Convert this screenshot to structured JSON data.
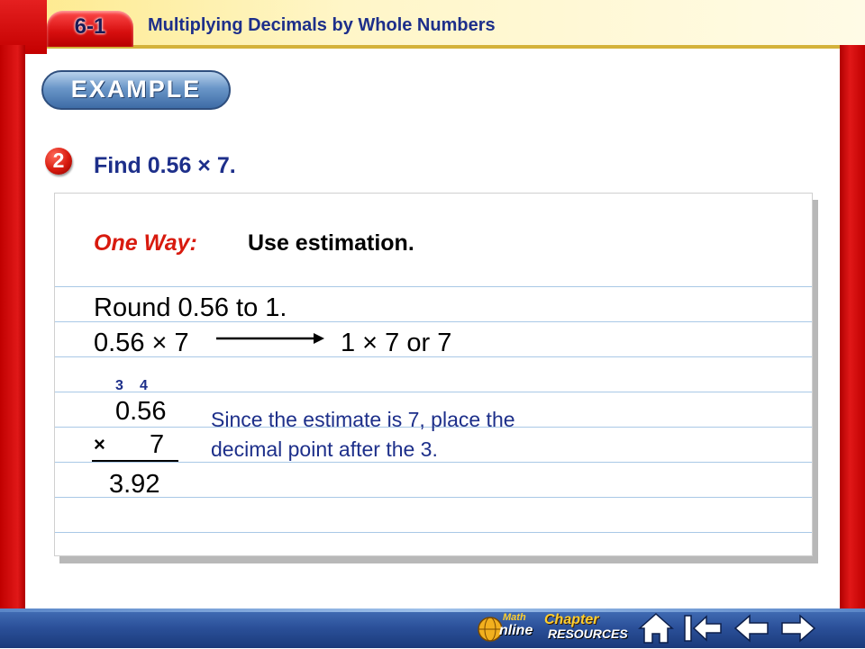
{
  "header": {
    "lesson_number": "6-1",
    "lesson_title": "Multiplying Decimals by Whole Numbers"
  },
  "example_badge": "EXAMPLE",
  "problem": {
    "number": "2",
    "title": "Find 0.56 × 7."
  },
  "method": {
    "label": "One Way:",
    "description": "Use estimation."
  },
  "estimation": {
    "round_text": "Round 0.56 to 1.",
    "expression_left": "0.56 × 7",
    "expression_right": "1 × 7 or 7"
  },
  "multiplication": {
    "carry_digits": [
      "3",
      "4"
    ],
    "factor1": "0.56",
    "times_sign": "×",
    "factor2": "7",
    "product": "3.92"
  },
  "explanation": "Since the estimate is 7, place the decimal point after the 3.",
  "footer": {
    "math_online_top": "Math",
    "math_online_bottom": "nline",
    "chapter_resources_top": "Chapter",
    "chapter_resources_bottom": "RESOURCES"
  },
  "colors": {
    "title_blue": "#1d2f8a",
    "accent_red": "#d81a0e",
    "rule_blue": "#a9c8e6",
    "footer_blue": "#2a4f98"
  }
}
